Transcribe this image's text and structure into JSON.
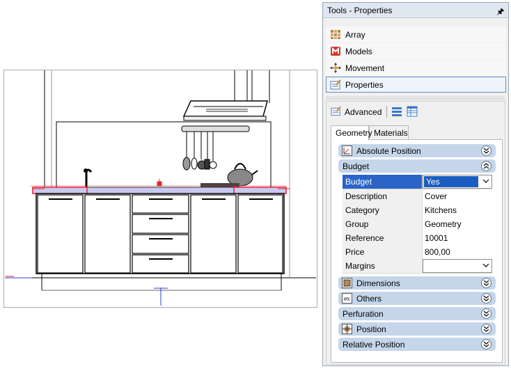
{
  "panel": {
    "title": "Tools - Properties",
    "pin_icon": "pin-icon",
    "tools": [
      {
        "label": "Array",
        "icon": "array-icon"
      },
      {
        "label": "Models",
        "icon": "models-icon"
      },
      {
        "label": "Movement",
        "icon": "movement-icon"
      },
      {
        "label": "Properties",
        "icon": "properties-icon",
        "selected": true
      }
    ],
    "advanced_label": "Advanced",
    "tabs": [
      {
        "label": "Geometry",
        "active": true
      },
      {
        "label": "Materials",
        "active": false
      }
    ],
    "groups": {
      "absolute_position": "Absolute Position",
      "budget": "Budget",
      "dimensions": "Dimensions",
      "others": "Others",
      "perfuration": "Perfuration",
      "position": "Position",
      "relative_position": "Relative Position"
    },
    "budget_props": [
      {
        "key": "Budget",
        "value": "Yes"
      },
      {
        "key": "Description",
        "value": "Cover"
      },
      {
        "key": "Category",
        "value": "Kitchens"
      },
      {
        "key": "Group",
        "value": "Geometry"
      },
      {
        "key": "Reference",
        "value": "10001"
      },
      {
        "key": "Price",
        "value": "800,00"
      },
      {
        "key": "Margins",
        "value": ""
      }
    ],
    "others_icon_text": "etc"
  },
  "colors": {
    "accent": "#2b64c7",
    "group_header": "#c5d6ea",
    "countertop": "#c9c9f0",
    "selection_red": "#e8252f"
  }
}
